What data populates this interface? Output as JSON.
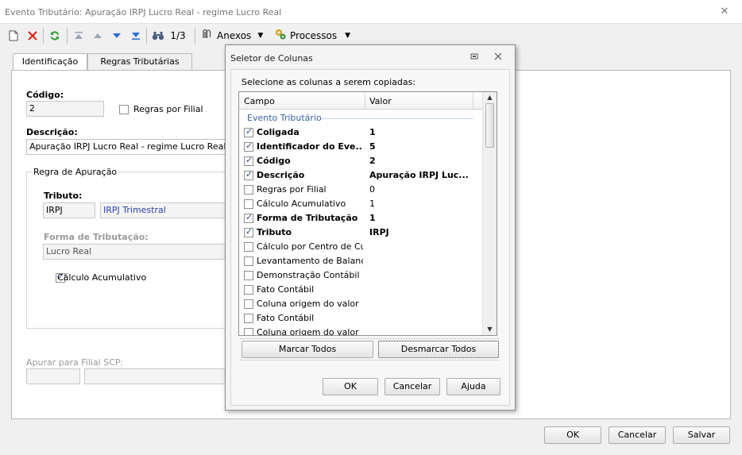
{
  "window": {
    "title": "Evento Tributário: Apuração IRPJ Lucro Real - regime Lucro Real",
    "close_glyph": "✕"
  },
  "toolbar": {
    "record_counter": "1/3",
    "anexos_label": "Anexos",
    "processos_label": "Processos",
    "icons": [
      "new-document-icon",
      "delete-icon",
      "refresh-icon",
      "first-record-icon",
      "previous-record-icon",
      "next-record-icon",
      "last-record-icon",
      "binoculars-icon",
      "attachments-icon",
      "processes-icon"
    ]
  },
  "tabs": [
    {
      "label": "Identificação",
      "active": true
    },
    {
      "label": "Regras Tributárias",
      "active": false
    }
  ],
  "form": {
    "codigo_label": "Código:",
    "codigo_value": "2",
    "regras_por_filial_label": "Regras por Filial",
    "regras_por_filial_checked": false,
    "descricao_label": "Descrição:",
    "descricao_value": "Apuração IRPJ Lucro Real - regime Lucro Real",
    "regra_apuracao_title": "Regra de Apuração",
    "tributo_label": "Tributo:",
    "tributo_code": "IRPJ",
    "tributo_desc": "IRPJ Trimestral",
    "forma_tributacao_label": "Forma de Tributação:",
    "forma_tributacao_value": "Lucro Real",
    "calculo_acumulativo_label": "Cálculo Acumulativo",
    "calculo_acumulativo_checked": true,
    "apurar_filial_label": "Apurar para Filial SCP:"
  },
  "footer": {
    "ok": "OK",
    "cancelar": "Cancelar",
    "salvar": "Salvar"
  },
  "dialog": {
    "title": "Seletor de Colunas",
    "instruction": "Selecione as colunas a serem copiadas:",
    "col_campo": "Campo",
    "col_valor": "Valor",
    "group": "Evento Tributário",
    "rows": [
      {
        "campo": "Coligada",
        "valor": "1",
        "checked": true
      },
      {
        "campo": "Identificador do Eve...",
        "valor": "5",
        "checked": true
      },
      {
        "campo": "Código",
        "valor": "2",
        "checked": true
      },
      {
        "campo": "Descrição",
        "valor": "Apuração IRPJ Luc...",
        "checked": true
      },
      {
        "campo": "Regras por Filial",
        "valor": "0",
        "checked": false
      },
      {
        "campo": "Cálculo Acumulativo",
        "valor": "1",
        "checked": false
      },
      {
        "campo": "Forma de Tributação",
        "valor": "1",
        "checked": true
      },
      {
        "campo": "Tributo",
        "valor": "IRPJ",
        "checked": true
      },
      {
        "campo": "Cálculo por Centro de Custo",
        "valor": "",
        "checked": false
      },
      {
        "campo": "Levantamento de Balanç...",
        "valor": "",
        "checked": false
      },
      {
        "campo": "Demonstração Contábil",
        "valor": "",
        "checked": false
      },
      {
        "campo": "Fato Contábil",
        "valor": "",
        "checked": false
      },
      {
        "campo": "Coluna origem do valor",
        "valor": "",
        "checked": false
      },
      {
        "campo": "Fato Contábil",
        "valor": "",
        "checked": false
      },
      {
        "campo": "Coluna origem do valor",
        "valor": "",
        "checked": false
      }
    ],
    "marcar_todos": "Marcar Todos",
    "desmarcar_todos": "Desmarcar Todos",
    "ok": "OK",
    "cancelar": "Cancelar",
    "ajuda": "Ajuda"
  }
}
